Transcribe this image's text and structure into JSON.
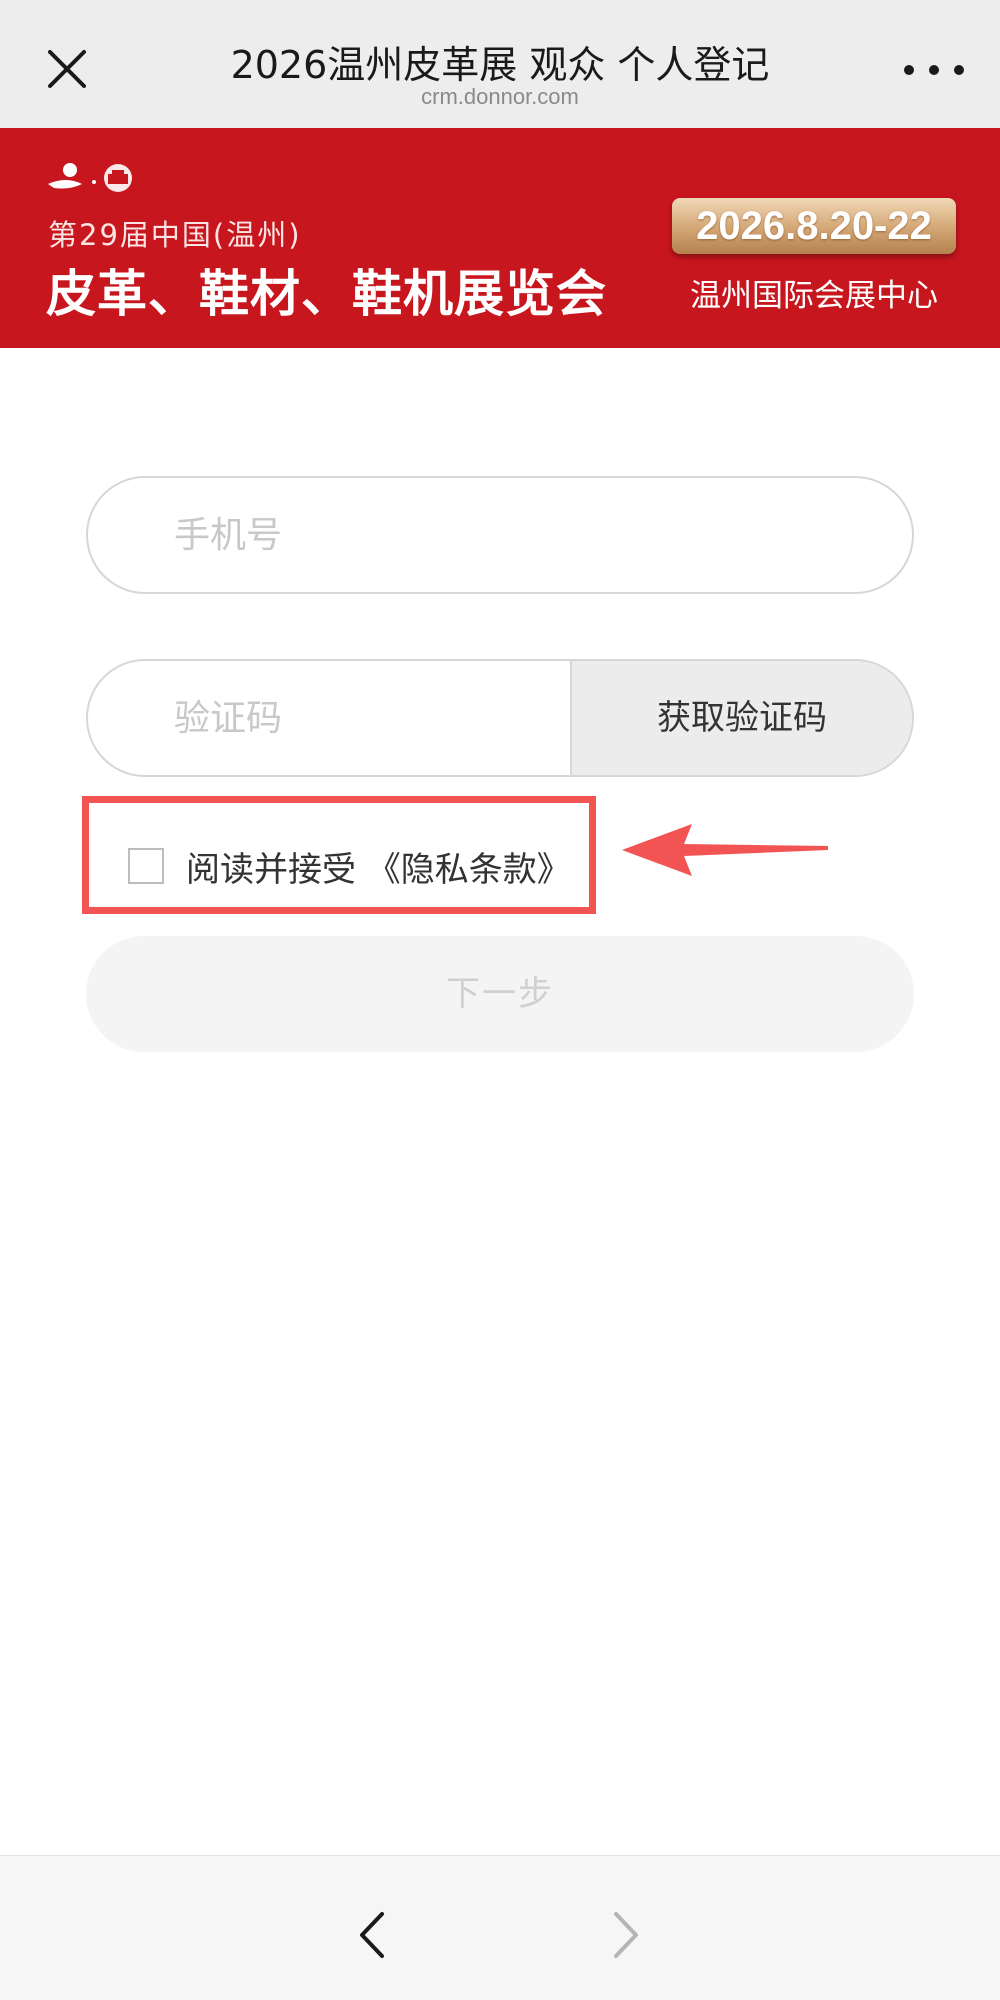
{
  "navbar": {
    "title": "2026温州皮革展 观众 个人登记",
    "url": "crm.donnor.com",
    "close_icon": "close-icon",
    "more_icon": "more-icon"
  },
  "banner": {
    "edition": "第29届中国(温州)",
    "name": "皮革、鞋材、鞋机展览会",
    "date": "2026.8.20-22",
    "venue": "温州国际会展中心",
    "color": "#c8161e"
  },
  "form": {
    "phone": {
      "placeholder": "手机号",
      "value": ""
    },
    "code": {
      "placeholder": "验证码",
      "value": ""
    },
    "get_code_label": "获取验证码",
    "privacy": {
      "checked": false,
      "label": "阅读并接受 《隐私条款》"
    },
    "next_label": "下一步"
  },
  "annotation": {
    "highlight_color": "#f25454"
  },
  "bottombar": {
    "back_icon": "chevron-left-icon",
    "forward_icon": "chevron-right-icon"
  }
}
